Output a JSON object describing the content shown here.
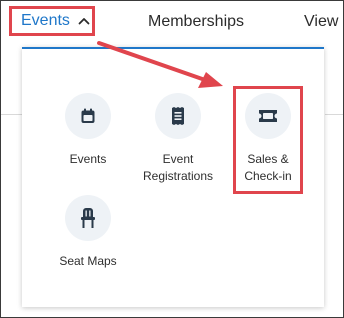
{
  "nav": {
    "events_label": "Events",
    "memberships_label": "Memberships",
    "view_label": "View"
  },
  "dropdown": {
    "items": [
      {
        "label": "Events",
        "icon": "calendar-icon"
      },
      {
        "label": "Event\nRegistrations",
        "icon": "receipt-icon"
      },
      {
        "label": "Sales &\nCheck-in",
        "icon": "ticket-icon"
      },
      {
        "label": "Seat Maps",
        "icon": "chair-icon"
      }
    ]
  },
  "colors": {
    "accent": "#1f77c9",
    "annotation_red": "#e0454d",
    "icon_dark": "#2a3a4a",
    "icon_circle_bg": "#eef2f6"
  }
}
